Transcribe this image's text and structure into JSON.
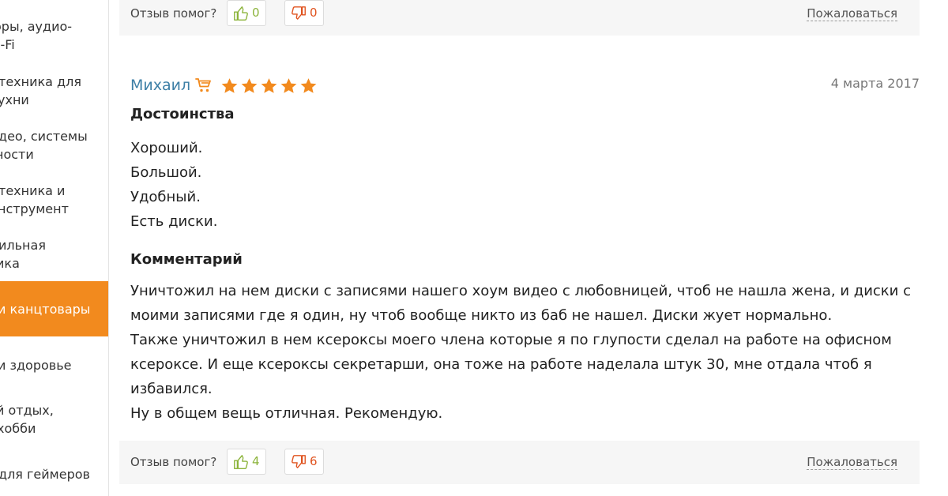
{
  "sidebar": {
    "items": [
      {
        "lines": [
          "оры, аудио-",
          "i-Fi"
        ],
        "active": false
      },
      {
        "lines": [
          "техника для",
          "ухни"
        ],
        "active": false
      },
      {
        "lines": [
          "део, системы",
          "ности"
        ],
        "active": false
      },
      {
        "lines": [
          "техника и",
          "нструмент"
        ],
        "active": false
      },
      {
        "lines": [
          "ильная",
          "ика"
        ],
        "active": false
      },
      {
        "lines": [
          "и канцтовары"
        ],
        "active": true
      },
      {
        "lines": [
          "и здоровье"
        ],
        "active": false
      },
      {
        "lines": [
          "й отдых,",
          "хобби"
        ],
        "active": false
      },
      {
        "lines": [
          "для геймеров"
        ],
        "active": false
      }
    ]
  },
  "top_bar": {
    "label": "Отзыв помог?",
    "up_count": "0",
    "down_count": "0",
    "complain": "Пожаловаться"
  },
  "review": {
    "author": "Михаил",
    "rating": 5,
    "date": "4 марта 2017",
    "pros_heading": "Достоинства",
    "pros": [
      "Хороший.",
      "Большой.",
      "Удобный.",
      "Есть диски."
    ],
    "comment_heading": "Комментарий",
    "comment_lines": [
      "Уничтожил на нем диски с записями нашего хоум видео с любовницей, чтоб не нашла жена, и диски с",
      "моими записями где я один, ну чтоб вообще никто из баб не нашел. Диски жует нормально.",
      "Также уничтожил в нем ксероксы моего члена которые я по глупости сделал на работе на офисном",
      "ксероксе. И еще ксероксы секретарши, она тоже на работе наделала штук 30, мне отдала чтоб я",
      "избавился.",
      "Ну в общем вещь отличная. Рекомендую."
    ]
  },
  "bottom_bar": {
    "label": "Отзыв помог?",
    "up_count": "4",
    "down_count": "6",
    "complain": "Пожаловаться"
  },
  "colors": {
    "accent": "#f28a1e",
    "author_link": "#3d7fa6",
    "star": "#f28a1e",
    "thumb_up": "#8bb33a",
    "thumb_down": "#e0531f"
  },
  "icons": {
    "cart": "shopping-cart-icon",
    "star": "star-icon",
    "thumb_up": "thumbs-up-icon",
    "thumb_down": "thumbs-down-icon"
  }
}
